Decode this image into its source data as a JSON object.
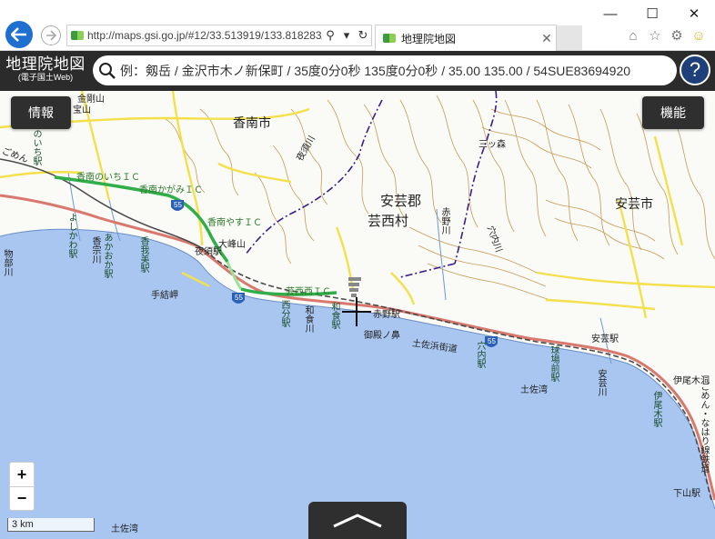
{
  "browser": {
    "url": "http://maps.gsi.go.jp/#12/33.513919/133.818283/",
    "tab_title": "地理院地図",
    "window_controls": [
      "minimize",
      "maximize",
      "close"
    ],
    "toolbar_icons": [
      "home-icon",
      "star-icon",
      "gear-icon",
      "smiley-icon"
    ]
  },
  "header": {
    "logo_main": "地理院地図",
    "logo_sub": "(電子国土Web)",
    "search_placeholder": "例：剱岳 / 金沢市木ノ新保町 / 35度0分0秒 135度0分0秒 / 35.00 135.00 / 54SUE83694920",
    "help_label": "?"
  },
  "map_controls": {
    "info_label": "情報",
    "function_label": "機能",
    "zoom_in": "+",
    "zoom_out": "−",
    "scale_label": "3 km"
  },
  "map_labels": {
    "kounan_city": "香南市",
    "aki_gun": "安芸郡",
    "geisei_mura": "芸西村",
    "aki_city": "安芸市",
    "sanjuumori": "三ッ森",
    "yasugawa": "夜須川",
    "akano_gawa": "赤野川",
    "anaigawa": "穴内川",
    "konan_noichi_ic": "香南のいちＩＣ",
    "konan_kagami_ic": "香南かがみＩＣ",
    "konan_yasu_ic": "香南やすＩＣ",
    "geisei_nishi_ic": "芸西西ＩＣ",
    "oominesan": "大峰山",
    "yasu_eki": "夜須駅",
    "tetsui_misaki": "手結岬",
    "akano_eki": "赤野駅",
    "mitonohana": "御殿ノ鼻",
    "tosahama_kaidou": "土佐浜街道",
    "aki_eki": "安芸駅",
    "iburi_eki": "伊尾木駅",
    "iburikibora": "伊尾木洞",
    "tosawan": "土佐湾",
    "tosawan2": "土佐湾",
    "shimoyama_eki": "下山駅",
    "kanemaru": "金剛山",
    "tosa_ra": "宝山",
    "gomen": "ごめん",
    "route_55a": "55",
    "route_55b": "55",
    "route_55c": "55",
    "noichi_eki": "のいち駅",
    "yoshikawa_eki": "よしかわ駅",
    "akaoka_eki": "あかおか駅",
    "kounoshi_gawa": "香宗川",
    "kagami_eki": "香我美駅",
    "monobe_gawa": "物部川",
    "nishibun_eki": "西分駅",
    "wajiki_gawa": "和食川",
    "wajiki_eki": "和食駅",
    "anai_eki": "穴内駅",
    "kyuujouzen_eki": "球場前駅",
    "aki_gawa": "安芸川",
    "iwanoki_eki": "伊尾木駅",
    "tetsudou": "ごめん・なはり線鉄道"
  },
  "colors": {
    "sea": "#a9c6f0",
    "land": "#fafaf7",
    "road_yellow": "#f4e04a",
    "road_red": "#d9786e",
    "highway_green": "#2fae49",
    "contour": "#c69a52",
    "rail": "#4a4a4a",
    "header": "#2b2b2b",
    "help": "#1f3f7a"
  }
}
